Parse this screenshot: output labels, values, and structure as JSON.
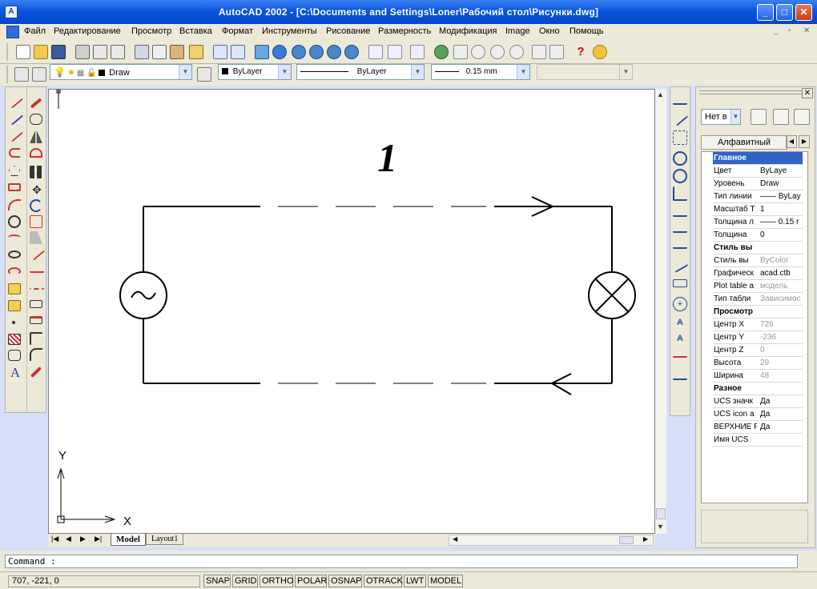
{
  "window": {
    "title": "AutoCAD 2002 - [C:\\Documents and Settings\\Loner\\Рабочий стол\\Рисунки.dwg]"
  },
  "menu": [
    "Файл",
    "Редактирование",
    "Просмотр",
    "Вставка",
    "Формат",
    "Инструменты",
    "Рисование",
    "Размерность",
    "Модификация",
    "Image",
    "Окно",
    "Помощь"
  ],
  "layers": {
    "current_layer": "Draw",
    "color": "ByLayer",
    "linetype": "ByLayer",
    "lineweight": "0.15 mm"
  },
  "drawing": {
    "label": "1",
    "ucs_x": "X",
    "ucs_y": "Y"
  },
  "tabs": {
    "model": "Model",
    "layout": "Layout1"
  },
  "properties": {
    "selector": "Нет в",
    "tab": "Алфавитный",
    "rows": [
      {
        "name": "Главное",
        "value": "",
        "category": true
      },
      {
        "name": "Цвет",
        "value": "ByLaye"
      },
      {
        "name": "Уровень",
        "value": "Draw"
      },
      {
        "name": "Тип линии",
        "value": "—— ByLay"
      },
      {
        "name": "Масштаб Т",
        "value": "1"
      },
      {
        "name": "Толщина л",
        "value": "—— 0.15 r"
      },
      {
        "name": "Толщина",
        "value": "0"
      },
      {
        "name": "Стиль вы",
        "value": "",
        "category": true
      },
      {
        "name": "Стиль вы",
        "value": "ByColor"
      },
      {
        "name": "Графическ",
        "value": "acad.ctb"
      },
      {
        "name": "Plot table a",
        "value": "модель"
      },
      {
        "name": "Тип табли",
        "value": "Зависимос"
      },
      {
        "name": "Просмотр",
        "value": "",
        "category": true
      },
      {
        "name": "Центр X",
        "value": "726"
      },
      {
        "name": "Центр Y",
        "value": "-236"
      },
      {
        "name": "Центр Z",
        "value": "0"
      },
      {
        "name": "Высота",
        "value": "29"
      },
      {
        "name": "Ширина",
        "value": "48"
      },
      {
        "name": "Разное",
        "value": "",
        "category": true
      },
      {
        "name": "UCS значк",
        "value": "Да"
      },
      {
        "name": "UCS icon a",
        "value": "Да"
      },
      {
        "name": "ВЕРХНИЕ Р",
        "value": "Да"
      },
      {
        "name": "Имя UCS",
        "value": ""
      }
    ]
  },
  "command": {
    "prompt": "Command :"
  },
  "status": {
    "coordinates": "707, -221, 0",
    "toggles": [
      "SNAP",
      "GRID",
      "ORTHO",
      "POLAR",
      "OSNAP",
      "OTRACK",
      "LWT",
      "MODEL"
    ]
  }
}
